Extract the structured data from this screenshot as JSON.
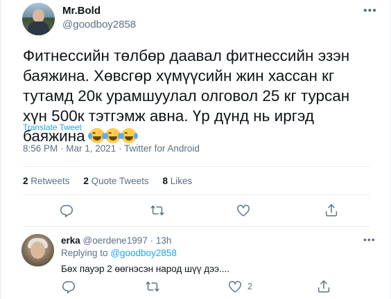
{
  "tweet": {
    "author_name": "Mr.Bold",
    "author_handle": "@goodboy2858",
    "text": "Фитнессийн төлбөр даавал фитнессийн эзэн баяжина. Хөвсгөр хүмүүсийн жин хассан кг тутамд 20к урамшуулал олговол 25 кг турсан хүн 500к тэтгэмж авна. Үр дүнд нь иргэд баяжина",
    "emoji_name": "face-with-tears-of-joy",
    "emoji_count": 3,
    "translate_label": "Translate Tweet",
    "timestamp": "8:56 PM · Mar 1, 2021 · Twitter for Android",
    "stats": {
      "retweets_num": "2",
      "retweets_label": "Retweets",
      "quotes_num": "2",
      "quotes_label": "Quote Tweets",
      "likes_num": "8",
      "likes_label": "Likes"
    }
  },
  "reply": {
    "author_name": "erka",
    "author_handle": "@oerdene1997",
    "separator": "·",
    "time": "13h",
    "replying_prefix": "Replying to",
    "replying_to": "@goodboy2858",
    "text": "Бөх пауэр 2 өөгнэсэн народ шүү дээ....",
    "like_count": "2"
  },
  "colors": {
    "accent": "#1da1f2",
    "secondary_text": "#5b7083",
    "divider": "#e6ecf0"
  }
}
